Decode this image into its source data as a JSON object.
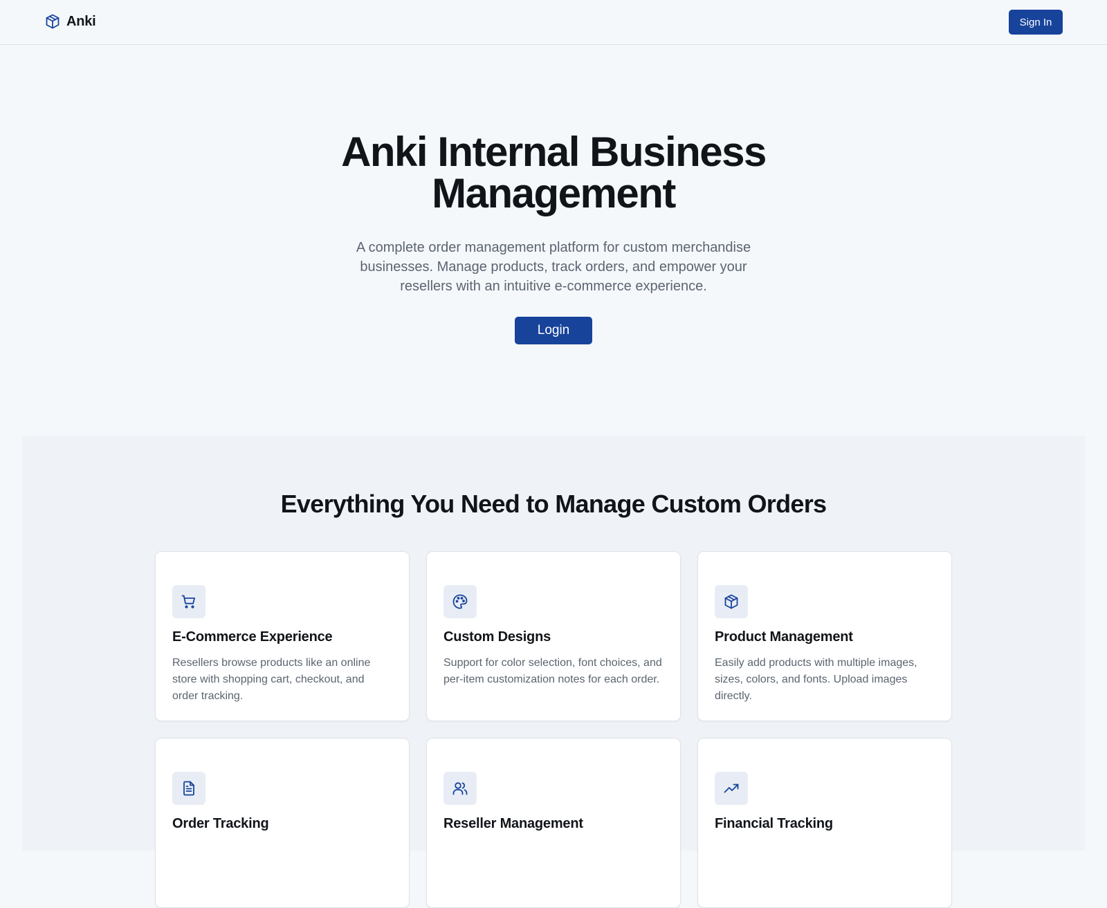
{
  "header": {
    "brand_name": "Anki",
    "brand_icon": "package-icon",
    "signin_label": "Sign In"
  },
  "hero": {
    "title": "Anki Internal Business Management",
    "subtitle": "A complete order management platform for custom merchandise businesses. Manage products, track orders, and empower your resellers with an intuitive e-commerce experience.",
    "login_label": "Login"
  },
  "features": {
    "title": "Everything You Need to Manage Custom Orders",
    "cards": [
      {
        "icon": "shopping-cart-icon",
        "title": "E-Commerce Experience",
        "description": "Resellers browse products like an online store with shopping cart, checkout, and order tracking."
      },
      {
        "icon": "palette-icon",
        "title": "Custom Designs",
        "description": "Support for color selection, font choices, and per-item customization notes for each order."
      },
      {
        "icon": "package-icon",
        "title": "Product Management",
        "description": "Easily add products with multiple images, sizes, colors, and fonts. Upload images directly."
      },
      {
        "icon": "file-text-icon",
        "title": "Order Tracking",
        "description": ""
      },
      {
        "icon": "users-icon",
        "title": "Reseller Management",
        "description": ""
      },
      {
        "icon": "trending-up-icon",
        "title": "Financial Tracking",
        "description": ""
      }
    ]
  },
  "colors": {
    "primary": "#17439b",
    "page_background": "#f5f8fb",
    "section_background": "#eff3f7",
    "icon_tile": "#e8edf5",
    "heading": "#111418",
    "muted_text": "#5b6470",
    "border": "#dfe3e8"
  }
}
